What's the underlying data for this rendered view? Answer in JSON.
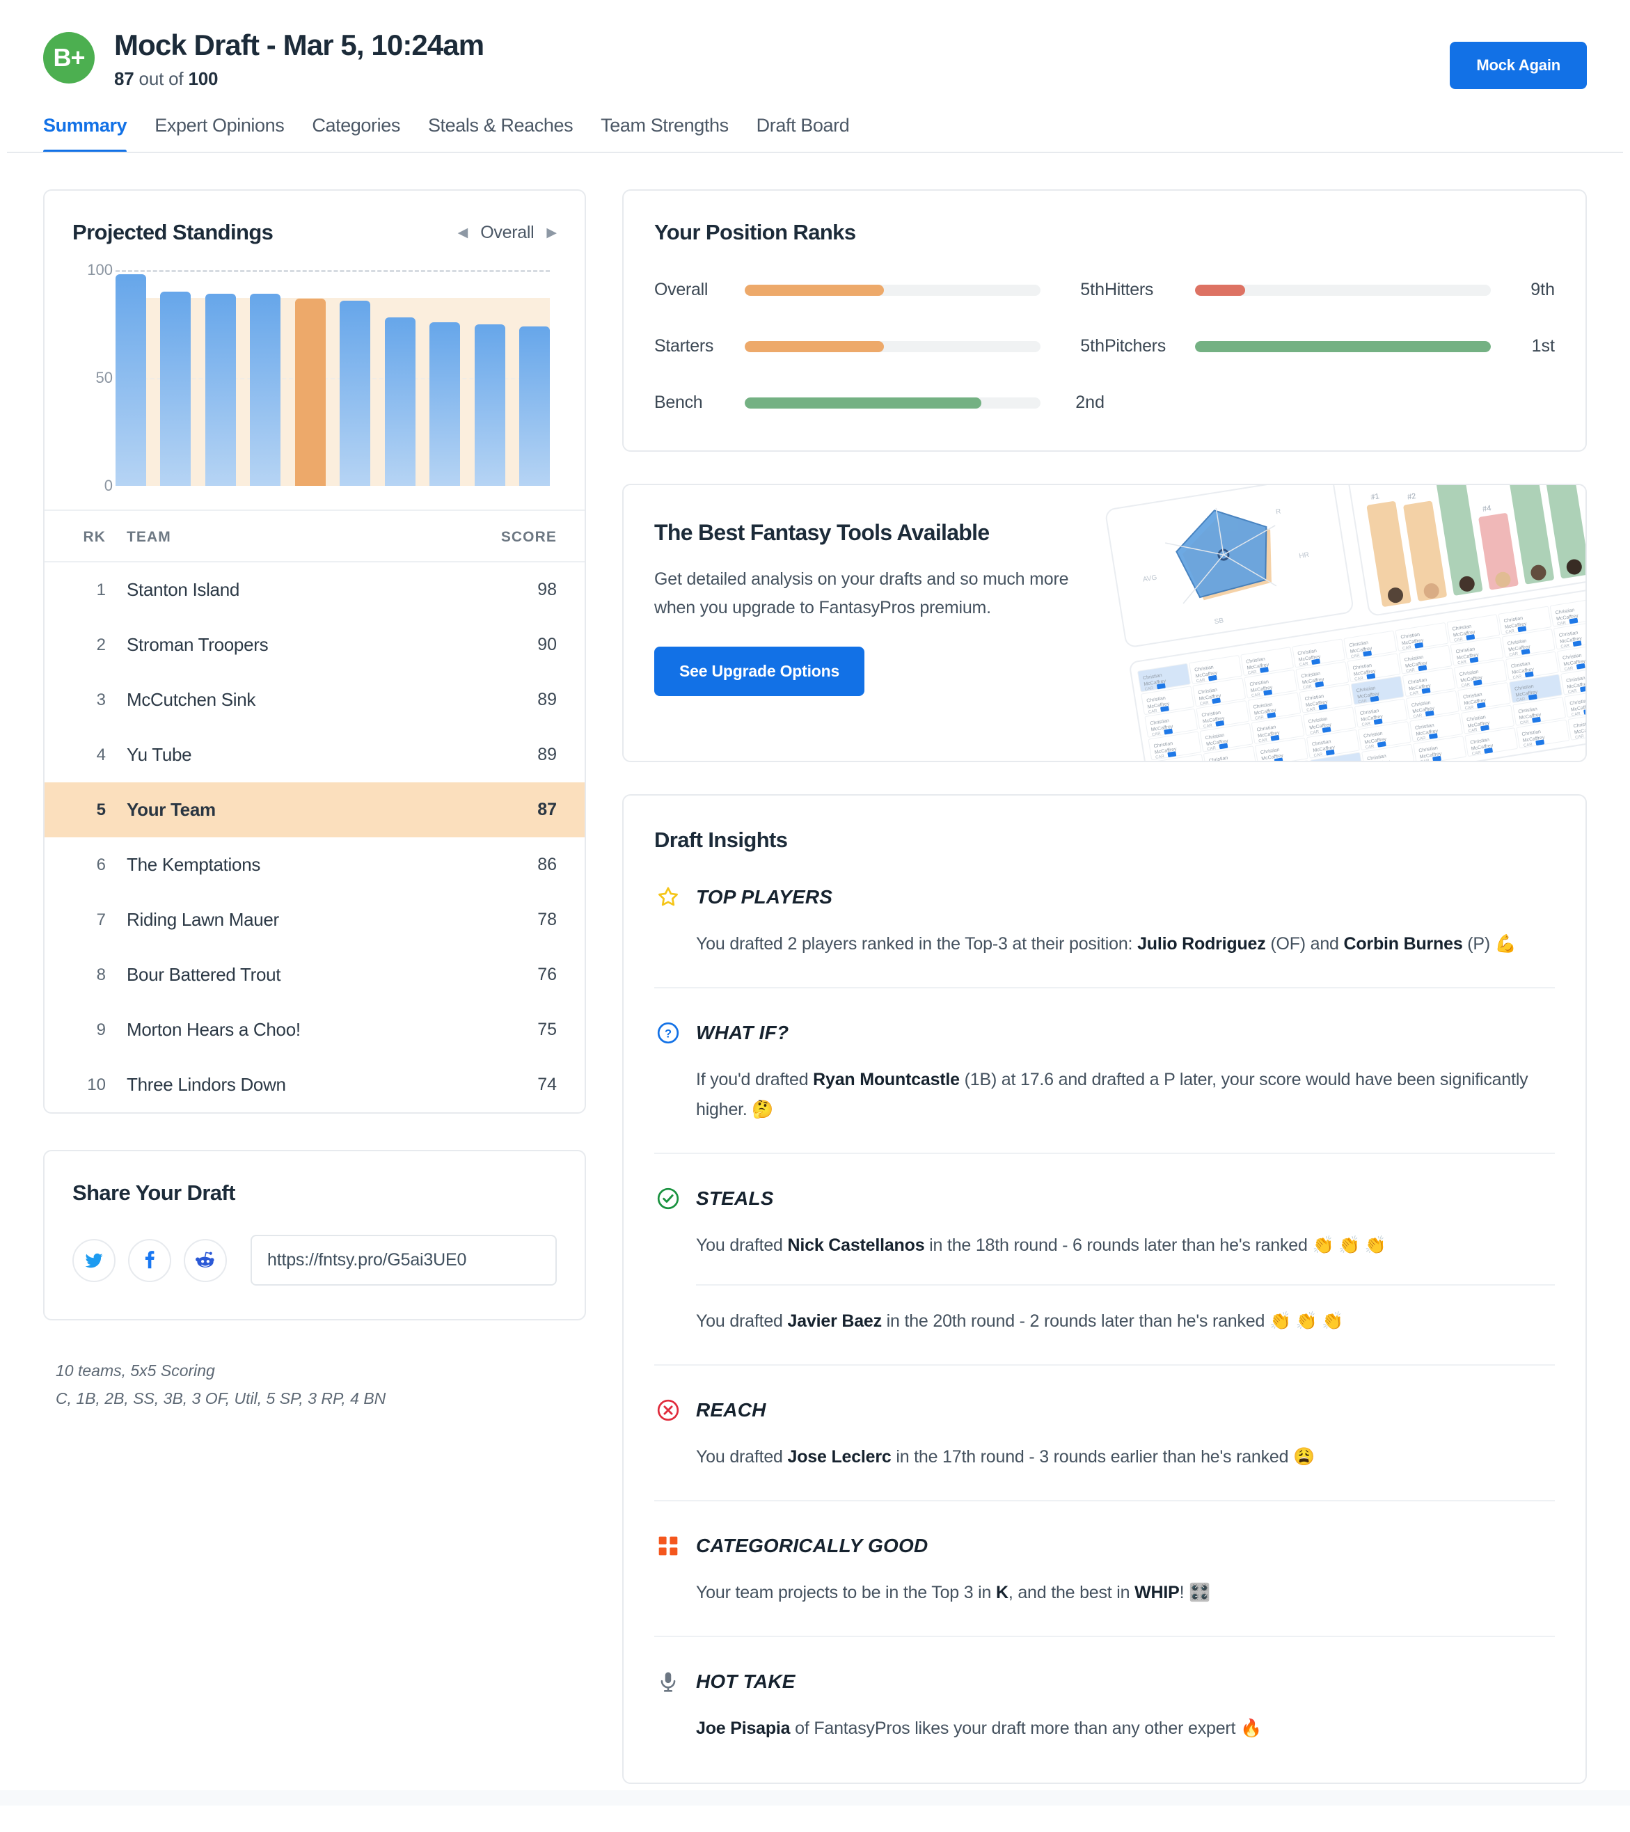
{
  "header": {
    "grade": "B+",
    "title": "Mock Draft - Mar 5, 10:24am",
    "score": "87",
    "score_suffix": " out of ",
    "score_max": "100",
    "mock_again_label": "Mock Again",
    "accent_blue": "#1271e6",
    "grade_green": "#4caf50"
  },
  "tabs": [
    {
      "label": "Summary",
      "active": true
    },
    {
      "label": "Expert Opinions",
      "active": false
    },
    {
      "label": "Categories",
      "active": false
    },
    {
      "label": "Steals & Reaches",
      "active": false
    },
    {
      "label": "Team Strengths",
      "active": false
    },
    {
      "label": "Draft Board",
      "active": false
    }
  ],
  "standings": {
    "title": "Projected Standings",
    "nav_label": "Overall",
    "prev_icon": "chevron-left-icon",
    "next_icon": "chevron-right-icon",
    "columns": {
      "rank": "RK",
      "team": "TEAM",
      "score": "SCORE"
    },
    "rows": [
      {
        "rank": "1",
        "team": "Stanton Island",
        "score": "98",
        "mine": false
      },
      {
        "rank": "2",
        "team": "Stroman Troopers",
        "score": "90",
        "mine": false
      },
      {
        "rank": "3",
        "team": "McCutchen Sink",
        "score": "89",
        "mine": false
      },
      {
        "rank": "4",
        "team": "Yu Tube",
        "score": "89",
        "mine": false
      },
      {
        "rank": "5",
        "team": "Your Team",
        "score": "87",
        "mine": true
      },
      {
        "rank": "6",
        "team": "The Kemptations",
        "score": "86",
        "mine": false
      },
      {
        "rank": "7",
        "team": "Riding Lawn Mauer",
        "score": "78",
        "mine": false
      },
      {
        "rank": "8",
        "team": "Bour Battered Trout",
        "score": "76",
        "mine": false
      },
      {
        "rank": "9",
        "team": "Morton Hears a Choo!",
        "score": "75",
        "mine": false
      },
      {
        "rank": "10",
        "team": "Three Lindors Down",
        "score": "74",
        "mine": false
      }
    ]
  },
  "chart_data": {
    "type": "bar",
    "title": "Projected Standings",
    "xlabel": "",
    "ylabel": "",
    "ylim": [
      0,
      100
    ],
    "yticks": [
      0,
      50,
      100
    ],
    "ytick_labels": [
      "0",
      "50",
      "100"
    ],
    "grid": true,
    "legend": null,
    "categories": [
      "Stanton Island",
      "Stroman Troopers",
      "McCutchen Sink",
      "Yu Tube",
      "Your Team",
      "The Kemptations",
      "Riding Lawn Mauer",
      "Bour Battered Trout",
      "Morton Hears a Choo!",
      "Three Lindors Down"
    ],
    "values": [
      98,
      90,
      89,
      89,
      87,
      86,
      78,
      76,
      75,
      74
    ],
    "highlight_index": 4,
    "highlight_color": "#eda96a",
    "bar_color": "#66a6ea",
    "band_value": 87,
    "band_color": "#fbeedd"
  },
  "position_ranks": {
    "title": "Your Position Ranks",
    "left": [
      {
        "label": "Overall",
        "value": "5th",
        "pct": 47,
        "color": "#eda96a"
      },
      {
        "label": "Starters",
        "value": "5th",
        "pct": 47,
        "color": "#eda96a"
      },
      {
        "label": "Bench",
        "value": "2nd",
        "pct": 80,
        "color": "#74b183"
      }
    ],
    "right": [
      {
        "label": "Hitters",
        "value": "9th",
        "pct": 17,
        "color": "#dd7263"
      },
      {
        "label": "Pitchers",
        "value": "1st",
        "pct": 100,
        "color": "#74b183"
      }
    ]
  },
  "promo": {
    "title": "The Best Fantasy Tools Available",
    "body": "Get detailed analysis on your drafts and so much more when you upgrade to FantasyPros premium.",
    "button_label": "See Upgrade Options",
    "art_name": "fantasy-tools-preview-image"
  },
  "share": {
    "title": "Share Your Draft",
    "url": "https://fntsy.pro/G5ai3UE0",
    "socials": [
      {
        "name": "twitter-icon",
        "label": "Twitter"
      },
      {
        "name": "facebook-icon",
        "label": "Facebook"
      },
      {
        "name": "reddit-icon",
        "label": "Reddit"
      }
    ]
  },
  "league_note": {
    "line1": "10 teams, 5x5 Scoring",
    "line2": "C, 1B, 2B, SS, 3B, 3 OF, Util, 5 SP, 3 RP, 4 BN"
  },
  "insights": {
    "title": "Draft Insights",
    "blocks": [
      {
        "icon": "star-icon",
        "name": "TOP PLAYERS",
        "lines": [
          {
            "html": "You drafted 2 players ranked in the Top-3 at their position: <b>Julio Rodriguez</b> (OF) and <b>Corbin Burnes</b> (P) 💪"
          }
        ]
      },
      {
        "icon": "question-circle-icon",
        "name": "WHAT IF?",
        "lines": [
          {
            "html": "If you'd drafted <b>Ryan Mountcastle</b> (1B) at 17.6 and drafted a P later, your score would have been significantly higher. 🤔"
          }
        ]
      },
      {
        "icon": "check-circle-icon",
        "name": "STEALS",
        "lines": [
          {
            "html": "You drafted <b>Nick Castellanos</b> in the 18th round - 6 rounds later than he's ranked 👏 👏 👏"
          },
          {
            "html": "You drafted <b>Javier Baez</b> in the 20th round - 2 rounds later than he's ranked 👏 👏 👏"
          }
        ]
      },
      {
        "icon": "x-circle-icon",
        "name": "REACH",
        "lines": [
          {
            "html": "You drafted <b>Jose Leclerc</b> in the 17th round - 3 rounds earlier than he's ranked 😩"
          }
        ]
      },
      {
        "icon": "grid-squares-icon",
        "name": "CATEGORICALLY GOOD",
        "lines": [
          {
            "html": "Your team projects to be in the Top 3 in <b>K</b>, and the best in <b>WHIP</b>! 🎛️"
          }
        ]
      },
      {
        "icon": "microphone-icon",
        "name": "HOT TAKE",
        "lines": [
          {
            "html": "<b>Joe Pisapia</b> of FantasyPros likes your draft more than any other expert 🔥"
          }
        ]
      }
    ]
  }
}
